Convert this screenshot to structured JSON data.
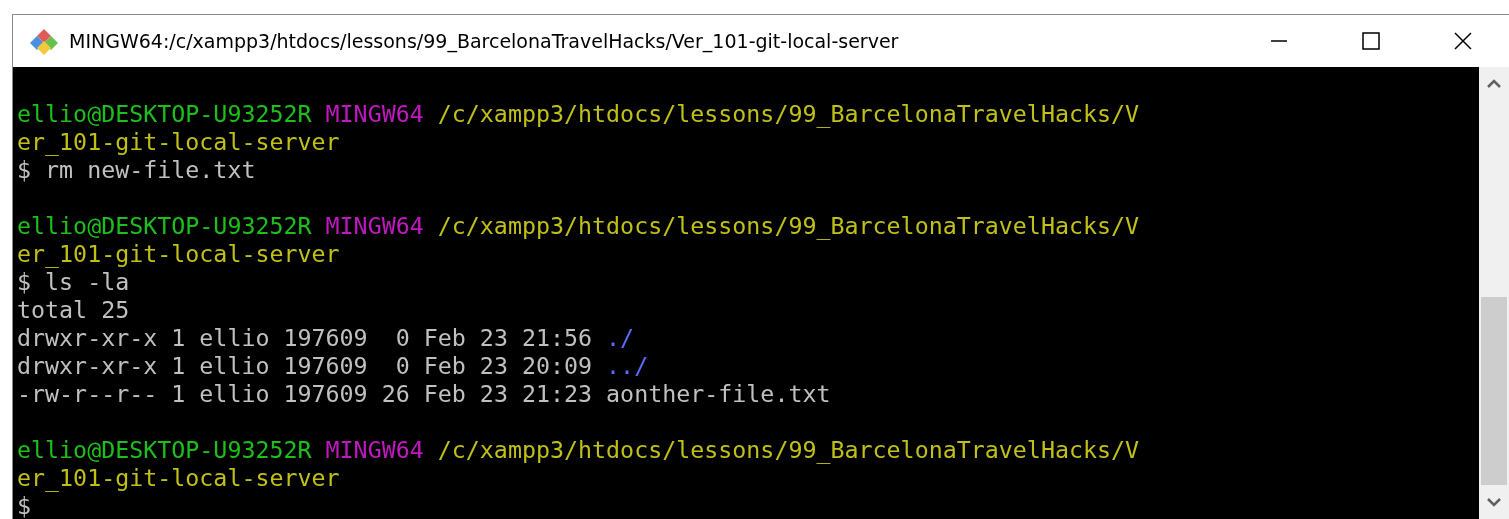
{
  "window": {
    "title": "MINGW64:/c/xampp3/htdocs/lessons/99_BarcelonaTravelHacks/Ver_101-git-local-server"
  },
  "terminal": {
    "lines": [
      {
        "kind": "blank"
      },
      {
        "kind": "text",
        "segments": [
          {
            "kind": "user",
            "text": "ellio@DESKTOP-U93252R"
          },
          {
            "kind": "host",
            "text": "MINGW64"
          },
          {
            "kind": "path",
            "text": "/c/xampp3/htdocs/lessons/99_BarcelonaTravelHacks/V"
          }
        ]
      },
      {
        "kind": "text",
        "segments": [
          {
            "kind": "path",
            "text": "er_101-git-local-server"
          }
        ]
      },
      {
        "kind": "text",
        "segments": [
          {
            "kind": "command",
            "text": "$ rm new-file.txt"
          }
        ]
      },
      {
        "kind": "blank"
      },
      {
        "kind": "text",
        "segments": [
          {
            "kind": "user",
            "text": "ellio@DESKTOP-U93252R"
          },
          {
            "kind": "host",
            "text": "MINGW64"
          },
          {
            "kind": "path",
            "text": "/c/xampp3/htdocs/lessons/99_BarcelonaTravelHacks/V"
          }
        ]
      },
      {
        "kind": "text",
        "segments": [
          {
            "kind": "path",
            "text": "er_101-git-local-server"
          }
        ]
      },
      {
        "kind": "text",
        "segments": [
          {
            "kind": "command",
            "text": "$ ls -la"
          }
        ]
      },
      {
        "kind": "text",
        "segments": [
          {
            "kind": "output",
            "text": "total 25"
          }
        ]
      },
      {
        "kind": "text",
        "segments": [
          {
            "kind": "output",
            "text": "drwxr-xr-x 1 ellio 197609  0 Feb 23 21:56"
          },
          {
            "kind": "dir",
            "text": "./"
          }
        ]
      },
      {
        "kind": "text",
        "segments": [
          {
            "kind": "output",
            "text": "drwxr-xr-x 1 ellio 197609  0 Feb 23 20:09"
          },
          {
            "kind": "dir",
            "text": "../"
          }
        ]
      },
      {
        "kind": "text",
        "segments": [
          {
            "kind": "output",
            "text": "-rw-r--r-- 1 ellio 197609 26 Feb 23 21:23 aonther-file.txt"
          }
        ]
      },
      {
        "kind": "blank"
      },
      {
        "kind": "text",
        "segments": [
          {
            "kind": "user",
            "text": "ellio@DESKTOP-U93252R"
          },
          {
            "kind": "host",
            "text": "MINGW64"
          },
          {
            "kind": "path",
            "text": "/c/xampp3/htdocs/lessons/99_BarcelonaTravelHacks/V"
          }
        ]
      },
      {
        "kind": "text",
        "segments": [
          {
            "kind": "path",
            "text": "er_101-git-local-server"
          }
        ]
      },
      {
        "kind": "text",
        "segments": [
          {
            "kind": "command",
            "text": "$"
          }
        ]
      }
    ]
  }
}
